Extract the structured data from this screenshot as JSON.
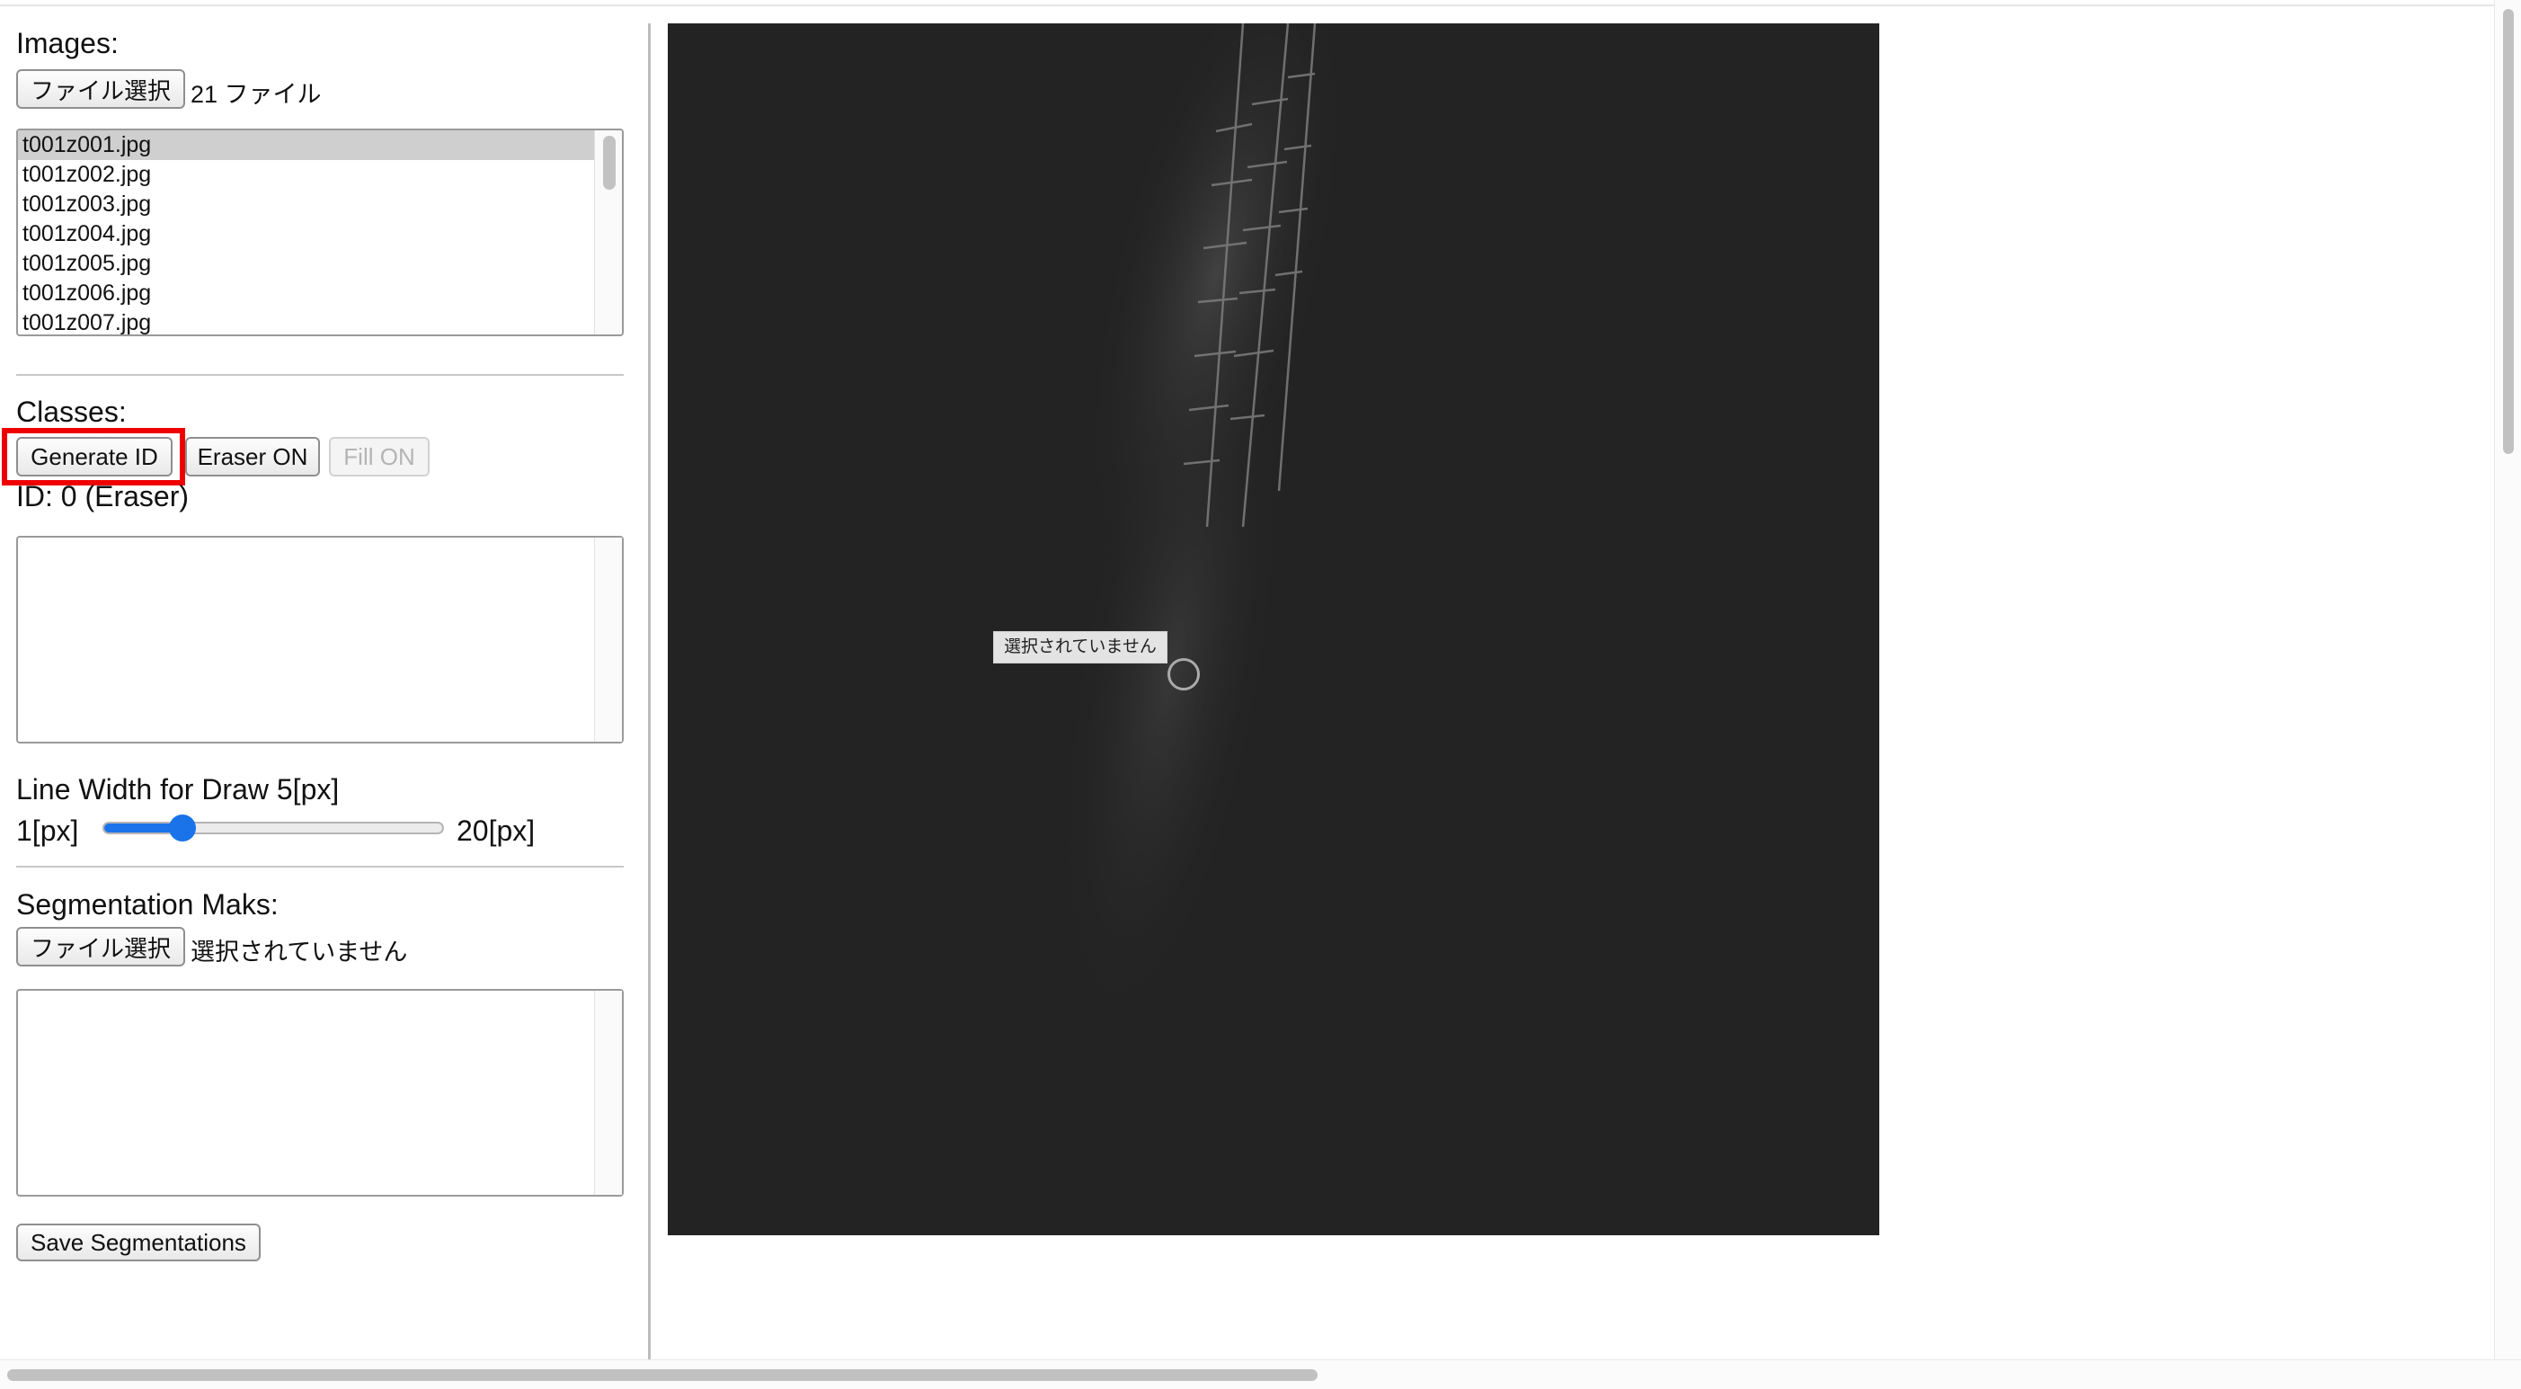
{
  "images_section": {
    "label": "Images:",
    "file_button_label": "ファイル選択",
    "file_status": "21 ファイル",
    "files": [
      "t001z001.jpg",
      "t001z002.jpg",
      "t001z003.jpg",
      "t001z004.jpg",
      "t001z005.jpg",
      "t001z006.jpg",
      "t001z007.jpg"
    ],
    "selected_file": "t001z001.jpg"
  },
  "classes_section": {
    "label": "Classes:",
    "generate_id_label": "Generate ID",
    "eraser_label": "Eraser ON",
    "fill_label": "Fill ON",
    "current_id": "ID: 0 (Eraser)"
  },
  "line_width": {
    "label": "Line Width for Draw 5[px]",
    "min_label": "1[px]",
    "max_label": "20[px]",
    "min": 1,
    "max": 20,
    "value": 5
  },
  "segmentation_section": {
    "label": "Segmentation Maks:",
    "file_button_label": "ファイル選択",
    "file_status": "選択されていません"
  },
  "save_button_label": "Save Segmentations",
  "canvas": {
    "tooltip_text": "選択されていません",
    "background_color": "#232323"
  },
  "colors": {
    "highlight": "#ee0000",
    "slider_accent": "#1a73e8"
  }
}
